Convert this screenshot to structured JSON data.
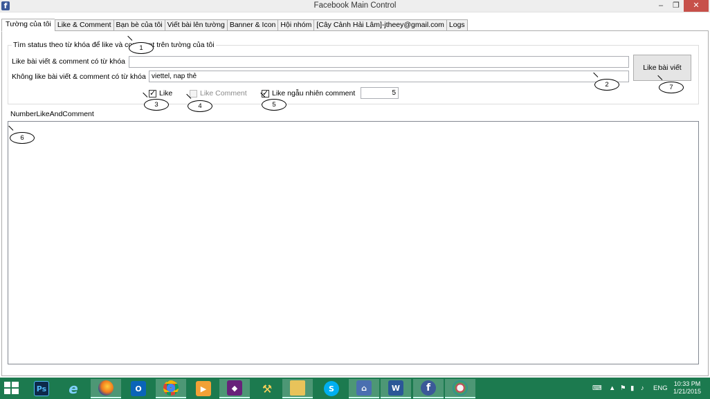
{
  "window": {
    "title": "Facebook Main Control",
    "app_icon": "f",
    "minimize_glyph": "–",
    "restore_glyph": "❐",
    "close_glyph": "✕"
  },
  "tabs": [
    {
      "label": "Tường của tôi",
      "active": true
    },
    {
      "label": "Like & Comment"
    },
    {
      "label": "Bạn bè của tôi"
    },
    {
      "label": "Viết bài lên tường"
    },
    {
      "label": "Banner &  Icon"
    },
    {
      "label": "Hội nhóm"
    },
    {
      "label": "[Cây Cảnh Hải Lâm]-jtheey@gmail.com"
    },
    {
      "label": "Logs"
    }
  ],
  "group": {
    "legend": "Tìm status theo từ khóa để like và comment trên tường của tôi",
    "like_keyword_label": "Like bài viết & comment có từ khóa",
    "like_keyword_value": "",
    "skip_keyword_label": "Không like bài viết & comment có từ khóa",
    "skip_keyword_value": "viettel, nap thẻ",
    "like_button": "Like bài viết",
    "check_like": {
      "label": "Like",
      "checked": true
    },
    "check_like_comment": {
      "label": "Like Comment",
      "checked": false,
      "disabled": true
    },
    "check_random": {
      "label": "Like ngẫu nhiên comment",
      "checked": true
    },
    "random_count": "5"
  },
  "number_label": "NumberLikeAndComment",
  "callouts": [
    "1",
    "2",
    "3",
    "4",
    "5",
    "6",
    "7"
  ],
  "taskbar": {
    "icons": [
      "start-icon",
      "photoshop-icon",
      "internet-explorer-icon",
      "firefox-icon",
      "outlook-icon",
      "chrome-icon",
      "media-player-icon",
      "visual-studio-icon",
      "tools-icon",
      "file-explorer-icon",
      "skype-icon",
      "network-icon",
      "word-icon",
      "facebook-icon",
      "paint-icon"
    ],
    "ps_label": "Ps",
    "ie_label": "e",
    "outlook_label": "O",
    "vs_label": "◆",
    "skype_label": "S",
    "word_label": "W",
    "fb_label": "f",
    "lang": "ENG",
    "time": "10:33 PM",
    "date": "1/21/2015"
  },
  "colors": {
    "taskbar": "#1c7a4f",
    "close_button": "#c7504a",
    "facebook_blue": "#3b5998"
  }
}
